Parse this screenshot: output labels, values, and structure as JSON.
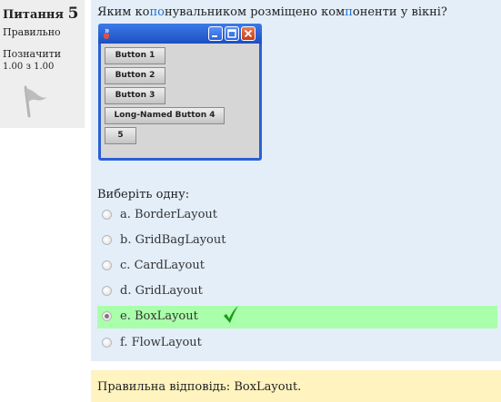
{
  "info": {
    "question_prefix": "Питання",
    "question_number": "5",
    "state": "Правильно",
    "mark_label": "Позначити",
    "mark_value": "1.00 з 1.00"
  },
  "question": {
    "text_parts": [
      "Яким ко",
      "по",
      "нувальником розміщено ком",
      "п",
      "оненти у вікні?"
    ]
  },
  "java_window": {
    "buttons": [
      "Button 1",
      "Button 2",
      "Button 3",
      "Long-Named Button 4",
      "5"
    ],
    "colors": {
      "titlebar": "#2a5fd6",
      "body": "#d6d6d6"
    }
  },
  "select_prompt": "Виберіть одну:",
  "options": [
    {
      "letter": "a.",
      "label": "BorderLayout",
      "selected": false
    },
    {
      "letter": "b.",
      "label": "GridBagLayout",
      "selected": false
    },
    {
      "letter": "c.",
      "label": "CardLayout",
      "selected": false
    },
    {
      "letter": "d.",
      "label": "GridLayout",
      "selected": false
    },
    {
      "letter": "e.",
      "label": "BoxLayout",
      "selected": true,
      "correct": true
    },
    {
      "letter": "f.",
      "label": "FlowLayout",
      "selected": false
    }
  ],
  "feedback": {
    "text": "Правильна відповідь: BoxLayout."
  },
  "colors": {
    "content_bg": "#e3eef9",
    "correct_bg": "#aaffaa",
    "feedback_bg": "#fff3bf",
    "check": "#1a9a1a"
  }
}
